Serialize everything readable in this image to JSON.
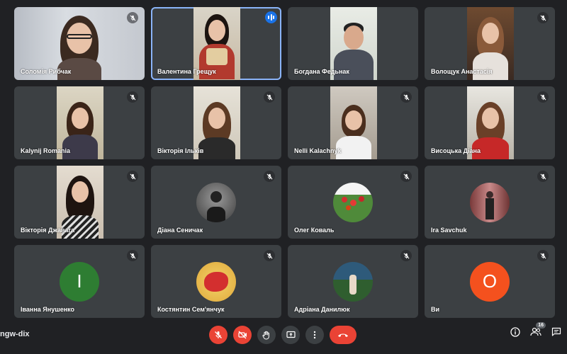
{
  "meeting": {
    "code": "ngw-dix"
  },
  "participants": [
    {
      "name": "Соломія Рибчак",
      "muted": true
    },
    {
      "name": "Валентина Грещук",
      "muted": false,
      "speaking": true
    },
    {
      "name": "Богдана Федьнак",
      "muted": false
    },
    {
      "name": "Волощук Анастасія",
      "muted": true
    },
    {
      "name": "Kalynij Romania",
      "muted": true
    },
    {
      "name": "Вікторія Ільків",
      "muted": true
    },
    {
      "name": "Nelli Kalachnyk",
      "muted": true
    },
    {
      "name": "Висоцька Діана",
      "muted": true
    },
    {
      "name": "Вікторія Джавага",
      "muted": true
    },
    {
      "name": "Діана Сеничак",
      "muted": true
    },
    {
      "name": "Олег Коваль",
      "muted": true
    },
    {
      "name": "Ira Savchuk",
      "muted": true
    },
    {
      "name": "Іванна Янушенко",
      "muted": true,
      "initial": "І",
      "avatar_color": "#2e7d32"
    },
    {
      "name": "Костянтин Сем'янчук",
      "muted": true
    },
    {
      "name": "Адріана Данилюк",
      "muted": true
    },
    {
      "name": "Ви",
      "muted": true,
      "initial": "О",
      "avatar_color": "#f4511e"
    }
  ],
  "toolbar": {
    "participant_count": "16"
  },
  "colors": {
    "background": "#202124",
    "tile": "#3c4043",
    "danger": "#ea4335",
    "active_border": "#8ab4f8",
    "speaking": "#1a73e8"
  }
}
